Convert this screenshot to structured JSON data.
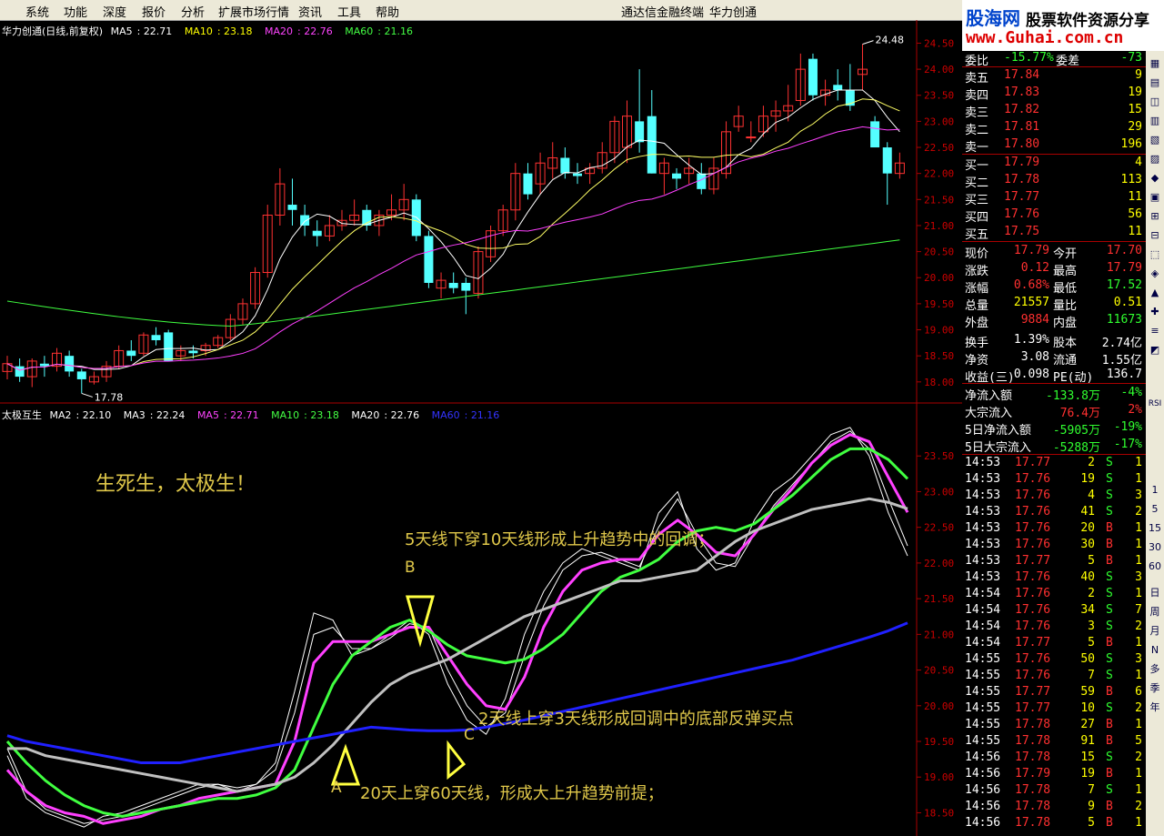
{
  "menu": [
    "系统",
    "功能",
    "深度",
    "报价",
    "分析",
    "扩展市场行情",
    "资讯",
    "工具",
    "帮助"
  ],
  "window_title": "通达信金融终端",
  "company": "华力创通",
  "logo": {
    "site_name": "股海网",
    "tagline": "股票软件资源分享",
    "url": "www.Guhai.com.cn"
  },
  "chart_data": [
    {
      "type": "candlestick",
      "title": "华力创通(日线,前复权)",
      "legend": [
        {
          "name": "MA5",
          "value": "22.71",
          "color": "#ffffff"
        },
        {
          "name": "MA10",
          "value": "23.18",
          "color": "#ffff00"
        },
        {
          "name": "MA20",
          "value": "22.76",
          "color": "#ff40ff"
        },
        {
          "name": "MA60",
          "value": "21.16",
          "color": "#40ff40"
        }
      ],
      "y_ticks": [
        "24.50",
        "24.00",
        "23.50",
        "23.00",
        "22.50",
        "22.00",
        "21.50",
        "21.00",
        "20.50",
        "20.00",
        "19.50",
        "19.00",
        "18.50",
        "18.00"
      ],
      "ylim": [
        17.7,
        24.7
      ],
      "annotations": [
        {
          "label": "24.48",
          "value": 24.48
        },
        {
          "label": "17.78",
          "value": 17.78
        }
      ],
      "ohlc": [
        [
          18.2,
          18.5,
          18.05,
          18.35
        ],
        [
          18.3,
          18.45,
          18.0,
          18.1
        ],
        [
          18.1,
          18.45,
          17.9,
          18.4
        ],
        [
          18.35,
          18.5,
          18.1,
          18.3
        ],
        [
          18.3,
          18.65,
          18.2,
          18.55
        ],
        [
          18.5,
          18.6,
          18.1,
          18.2
        ],
        [
          18.2,
          18.25,
          17.78,
          18.05
        ],
        [
          18.0,
          18.2,
          17.95,
          18.1
        ],
        [
          18.1,
          18.4,
          18.0,
          18.3
        ],
        [
          18.3,
          18.7,
          18.25,
          18.6
        ],
        [
          18.6,
          18.8,
          18.4,
          18.5
        ],
        [
          18.55,
          18.95,
          18.5,
          18.9
        ],
        [
          18.9,
          19.05,
          18.7,
          18.8
        ],
        [
          18.95,
          19.0,
          18.4,
          18.4
        ],
        [
          18.5,
          18.7,
          18.4,
          18.6
        ],
        [
          18.6,
          18.7,
          18.45,
          18.55
        ],
        [
          18.6,
          18.75,
          18.5,
          18.7
        ],
        [
          18.7,
          18.9,
          18.65,
          18.85
        ],
        [
          18.85,
          19.3,
          18.8,
          19.2
        ],
        [
          19.2,
          19.6,
          19.1,
          19.5
        ],
        [
          19.5,
          20.2,
          19.4,
          20.1
        ],
        [
          20.1,
          21.4,
          20.0,
          21.2
        ],
        [
          21.2,
          22.1,
          21.0,
          21.8
        ],
        [
          21.4,
          21.9,
          21.0,
          21.3
        ],
        [
          21.2,
          21.4,
          20.8,
          21.0
        ],
        [
          20.9,
          21.1,
          20.6,
          20.8
        ],
        [
          20.8,
          21.2,
          20.7,
          21.0
        ],
        [
          21.0,
          21.3,
          20.9,
          21.1
        ],
        [
          21.1,
          21.5,
          21.0,
          21.2
        ],
        [
          21.3,
          21.4,
          20.9,
          21.0
        ],
        [
          21.0,
          21.3,
          20.8,
          21.2
        ],
        [
          21.2,
          21.6,
          21.1,
          21.3
        ],
        [
          21.3,
          21.8,
          21.1,
          21.5
        ],
        [
          21.5,
          21.6,
          20.7,
          20.8
        ],
        [
          20.8,
          20.9,
          19.8,
          19.9
        ],
        [
          19.8,
          20.1,
          19.6,
          19.95
        ],
        [
          19.9,
          20.1,
          19.7,
          19.8
        ],
        [
          19.9,
          20.0,
          19.3,
          19.75
        ],
        [
          19.7,
          20.6,
          19.6,
          20.5
        ],
        [
          20.4,
          21.0,
          20.3,
          20.9
        ],
        [
          20.9,
          21.4,
          20.8,
          21.3
        ],
        [
          21.3,
          22.2,
          21.1,
          22.0
        ],
        [
          22.0,
          22.2,
          21.5,
          21.6
        ],
        [
          21.8,
          22.4,
          21.6,
          22.2
        ],
        [
          22.1,
          22.6,
          21.9,
          22.3
        ],
        [
          22.3,
          22.5,
          21.9,
          22.0
        ],
        [
          22.0,
          22.2,
          21.8,
          21.95
        ],
        [
          22.0,
          22.2,
          21.8,
          22.1
        ],
        [
          22.1,
          22.6,
          22.0,
          22.4
        ],
        [
          22.4,
          23.1,
          22.2,
          23.0
        ],
        [
          22.5,
          23.4,
          22.2,
          23.1
        ],
        [
          23.0,
          24.0,
          22.4,
          22.6
        ],
        [
          23.1,
          23.6,
          22.0,
          22.0
        ],
        [
          22.0,
          22.3,
          21.6,
          22.2
        ],
        [
          22.0,
          22.1,
          21.7,
          21.9
        ],
        [
          22.0,
          22.3,
          21.8,
          22.1
        ],
        [
          22.0,
          22.2,
          21.6,
          21.7
        ],
        [
          21.7,
          22.3,
          21.6,
          22.1
        ],
        [
          22.0,
          23.0,
          21.9,
          22.8
        ],
        [
          22.9,
          23.3,
          22.8,
          23.1
        ],
        [
          22.7,
          23.0,
          22.6,
          22.7
        ],
        [
          22.8,
          23.3,
          22.7,
          23.1
        ],
        [
          23.1,
          23.4,
          22.8,
          23.2
        ],
        [
          23.2,
          23.7,
          23.0,
          23.3
        ],
        [
          23.4,
          24.3,
          23.3,
          24.0
        ],
        [
          24.2,
          24.3,
          23.4,
          23.5
        ],
        [
          23.5,
          23.8,
          23.3,
          23.6
        ],
        [
          23.7,
          24.0,
          23.4,
          23.6
        ],
        [
          23.6,
          24.1,
          23.2,
          23.3
        ],
        [
          23.9,
          24.48,
          23.6,
          24.0
        ],
        [
          23.0,
          23.1,
          22.5,
          22.5
        ],
        [
          22.5,
          22.6,
          21.4,
          22.0
        ],
        [
          22.0,
          22.4,
          21.9,
          22.2
        ]
      ]
    },
    {
      "type": "line",
      "title": "太极互生",
      "legend": [
        {
          "name": "MA2",
          "value": "22.10",
          "color": "#ffffff"
        },
        {
          "name": "MA3",
          "value": "22.24",
          "color": "#ffffff"
        },
        {
          "name": "MA5",
          "value": "22.71",
          "color": "#ff40ff"
        },
        {
          "name": "MA10",
          "value": "23.18",
          "color": "#40ff40"
        },
        {
          "name": "MA20",
          "value": "22.76",
          "color": "#ffffff"
        },
        {
          "name": "MA60",
          "value": "21.16",
          "color": "#3030ff"
        }
      ],
      "y_ticks": [
        "23.50",
        "23.00",
        "22.50",
        "22.00",
        "21.50",
        "21.00",
        "20.50",
        "20.00",
        "19.50",
        "19.00",
        "18.50"
      ],
      "ylim": [
        18.2,
        24.0
      ],
      "series": [
        {
          "name": "MA2",
          "color": "#ffffff",
          "values": [
            19.3,
            18.7,
            18.5,
            18.4,
            18.3,
            18.45,
            18.5,
            18.6,
            18.7,
            18.8,
            18.9,
            18.9,
            18.8,
            18.9,
            19.2,
            20.2,
            21.3,
            21.2,
            20.7,
            20.8,
            21.0,
            21.2,
            21.0,
            20.3,
            19.8,
            19.6,
            20.1,
            21.0,
            21.6,
            22.0,
            22.2,
            22.1,
            22.0,
            21.9,
            22.7,
            23.0,
            22.2,
            21.9,
            22.0,
            22.6,
            23.0,
            23.2,
            23.5,
            23.8,
            23.9,
            23.5,
            22.7,
            22.1
          ]
        },
        {
          "name": "MA3",
          "color": "#ffffff",
          "values": [
            19.4,
            18.8,
            18.55,
            18.45,
            18.35,
            18.4,
            18.45,
            18.55,
            18.65,
            18.75,
            18.85,
            18.9,
            18.85,
            18.9,
            19.1,
            19.9,
            21.0,
            21.1,
            20.8,
            20.8,
            20.95,
            21.15,
            21.1,
            20.5,
            20.0,
            19.7,
            19.9,
            20.7,
            21.4,
            21.9,
            22.1,
            22.15,
            22.05,
            21.95,
            22.5,
            22.9,
            22.4,
            22.0,
            21.95,
            22.4,
            22.8,
            23.1,
            23.4,
            23.7,
            23.85,
            23.6,
            22.9,
            22.24
          ]
        },
        {
          "name": "MA5",
          "color": "#ff40ff",
          "values": [
            19.1,
            18.8,
            18.6,
            18.5,
            18.45,
            18.35,
            18.4,
            18.45,
            18.55,
            18.6,
            18.7,
            18.75,
            18.8,
            18.85,
            18.9,
            19.5,
            20.6,
            20.9,
            20.9,
            20.9,
            21.0,
            21.1,
            21.1,
            20.7,
            20.3,
            20.0,
            19.95,
            20.4,
            21.1,
            21.6,
            21.9,
            22.0,
            22.05,
            22.05,
            22.4,
            22.6,
            22.4,
            22.15,
            22.1,
            22.4,
            22.75,
            23.05,
            23.4,
            23.65,
            23.8,
            23.7,
            23.2,
            22.71
          ]
        },
        {
          "name": "MA10",
          "color": "#40ff40",
          "values": [
            19.5,
            19.2,
            18.95,
            18.75,
            18.6,
            18.5,
            18.45,
            18.5,
            18.55,
            18.6,
            18.65,
            18.7,
            18.7,
            18.75,
            18.85,
            19.1,
            19.7,
            20.3,
            20.7,
            20.9,
            21.1,
            21.2,
            21.05,
            20.85,
            20.7,
            20.65,
            20.6,
            20.65,
            20.8,
            21.0,
            21.3,
            21.6,
            21.8,
            21.9,
            22.05,
            22.3,
            22.45,
            22.5,
            22.45,
            22.55,
            22.75,
            22.95,
            23.2,
            23.45,
            23.6,
            23.6,
            23.45,
            23.18
          ]
        },
        {
          "name": "MA20",
          "color": "#c0c0c0",
          "values": [
            19.4,
            19.4,
            19.3,
            19.25,
            19.2,
            19.15,
            19.1,
            19.05,
            19.0,
            18.95,
            18.9,
            18.85,
            18.8,
            18.85,
            18.9,
            19.0,
            19.2,
            19.45,
            19.75,
            20.05,
            20.3,
            20.45,
            20.55,
            20.65,
            20.8,
            20.95,
            21.1,
            21.25,
            21.35,
            21.45,
            21.55,
            21.65,
            21.75,
            21.75,
            21.8,
            21.85,
            21.9,
            22.1,
            22.3,
            22.45,
            22.55,
            22.65,
            22.75,
            22.8,
            22.85,
            22.9,
            22.85,
            22.76
          ]
        },
        {
          "name": "MA60",
          "color": "#2020ff",
          "values": [
            19.58,
            19.5,
            19.45,
            19.4,
            19.35,
            19.3,
            19.25,
            19.2,
            19.2,
            19.2,
            19.25,
            19.3,
            19.35,
            19.4,
            19.45,
            19.5,
            19.55,
            19.6,
            19.65,
            19.7,
            19.68,
            19.66,
            19.65,
            19.65,
            19.66,
            19.7,
            19.75,
            19.8,
            19.86,
            19.92,
            19.98,
            20.04,
            20.1,
            20.16,
            20.22,
            20.28,
            20.34,
            20.4,
            20.46,
            20.52,
            20.58,
            20.64,
            20.72,
            20.8,
            20.88,
            20.96,
            21.05,
            21.16
          ]
        }
      ]
    }
  ],
  "annotations": {
    "title": "生死生，太极生！",
    "b_text": "5天线下穿10天线形成上升趋势中的回调；",
    "c_text": "2天线上穿3天线形成回调中的底部反弹买点",
    "a_text": "20天上穿60天线，形成大上升趋势前提；",
    "label_a": "A",
    "label_b": "B",
    "label_c": "C"
  },
  "quote": {
    "weibi_label": "委比",
    "weibi": "-15.77%",
    "weicha_label": "委差",
    "weicha": "-73",
    "sell": [
      {
        "label": "卖五",
        "price": "17.84",
        "vol": "9"
      },
      {
        "label": "卖四",
        "price": "17.83",
        "vol": "19"
      },
      {
        "label": "卖三",
        "price": "17.82",
        "vol": "15"
      },
      {
        "label": "卖二",
        "price": "17.81",
        "vol": "29"
      },
      {
        "label": "卖一",
        "price": "17.80",
        "vol": "196"
      }
    ],
    "buy": [
      {
        "label": "买一",
        "price": "17.79",
        "vol": "4"
      },
      {
        "label": "买二",
        "price": "17.78",
        "vol": "113"
      },
      {
        "label": "买三",
        "price": "17.77",
        "vol": "11"
      },
      {
        "label": "买四",
        "price": "17.76",
        "vol": "56"
      },
      {
        "label": "买五",
        "price": "17.75",
        "vol": "11"
      }
    ],
    "stats": [
      {
        "l1": "现价",
        "v1": "17.79",
        "c1": "#ff3030",
        "l2": "今开",
        "v2": "17.70",
        "c2": "#ff3030"
      },
      {
        "l1": "涨跌",
        "v1": "0.12",
        "c1": "#ff3030",
        "l2": "最高",
        "v2": "17.79",
        "c2": "#ff3030"
      },
      {
        "l1": "涨幅",
        "v1": "0.68%",
        "c1": "#ff3030",
        "l2": "最低",
        "v2": "17.52",
        "c2": "#30ff30"
      },
      {
        "l1": "总量",
        "v1": "21557",
        "c1": "#ffff00",
        "l2": "量比",
        "v2": "0.51",
        "c2": "#ffff00"
      },
      {
        "l1": "外盘",
        "v1": "9884",
        "c1": "#ff3030",
        "l2": "内盘",
        "v2": "11673",
        "c2": "#30ff30"
      },
      {
        "l1": "换手",
        "v1": "1.39%",
        "c1": "#ffffff",
        "l2": "股本",
        "v2": "2.74亿",
        "c2": "#ffffff"
      },
      {
        "l1": "净资",
        "v1": "3.08",
        "c1": "#ffffff",
        "l2": "流通",
        "v2": "1.55亿",
        "c2": "#ffffff"
      },
      {
        "l1": "收益(三)",
        "v1": "0.098",
        "c1": "#ffffff",
        "l2": "PE(动)",
        "v2": "136.7",
        "c2": "#ffffff"
      }
    ],
    "flows": [
      {
        "label": "净流入额",
        "value": "-133.8万",
        "pct": "-4%"
      },
      {
        "label": "大宗流入",
        "value": "76.4万",
        "pct": "2%"
      },
      {
        "label": "5日净流入额",
        "value": "-5905万",
        "pct": "-19%"
      },
      {
        "label": "5日大宗流入",
        "value": "-5288万",
        "pct": "-17%"
      }
    ],
    "ticks": [
      [
        "14:53",
        "17.77",
        "2",
        "S",
        "1"
      ],
      [
        "14:53",
        "17.76",
        "19",
        "S",
        "1"
      ],
      [
        "14:53",
        "17.76",
        "4",
        "S",
        "3"
      ],
      [
        "14:53",
        "17.76",
        "41",
        "S",
        "2"
      ],
      [
        "14:53",
        "17.76",
        "20",
        "B",
        "1"
      ],
      [
        "14:53",
        "17.76",
        "30",
        "B",
        "1"
      ],
      [
        "14:53",
        "17.77",
        "5",
        "B",
        "1"
      ],
      [
        "14:53",
        "17.76",
        "40",
        "S",
        "3"
      ],
      [
        "14:54",
        "17.76",
        "2",
        "S",
        "1"
      ],
      [
        "14:54",
        "17.76",
        "34",
        "S",
        "7"
      ],
      [
        "14:54",
        "17.76",
        "3",
        "S",
        "2"
      ],
      [
        "14:54",
        "17.77",
        "5",
        "B",
        "1"
      ],
      [
        "14:55",
        "17.76",
        "50",
        "S",
        "3"
      ],
      [
        "14:55",
        "17.76",
        "7",
        "S",
        "1"
      ],
      [
        "14:55",
        "17.77",
        "59",
        "B",
        "6"
      ],
      [
        "14:55",
        "17.77",
        "10",
        "S",
        "2"
      ],
      [
        "14:55",
        "17.78",
        "27",
        "B",
        "1"
      ],
      [
        "14:55",
        "17.78",
        "91",
        "B",
        "5"
      ],
      [
        "14:56",
        "17.78",
        "15",
        "S",
        "2"
      ],
      [
        "14:56",
        "17.79",
        "19",
        "B",
        "1"
      ],
      [
        "14:56",
        "17.78",
        "7",
        "S",
        "1"
      ],
      [
        "14:56",
        "17.78",
        "9",
        "B",
        "2"
      ],
      [
        "14:56",
        "17.78",
        "5",
        "B",
        "1"
      ]
    ]
  },
  "toolbar": [
    "日",
    "周",
    "月",
    "N",
    "多",
    "季",
    "年",
    "1",
    "5",
    "15",
    "30",
    "60",
    "RSI"
  ]
}
